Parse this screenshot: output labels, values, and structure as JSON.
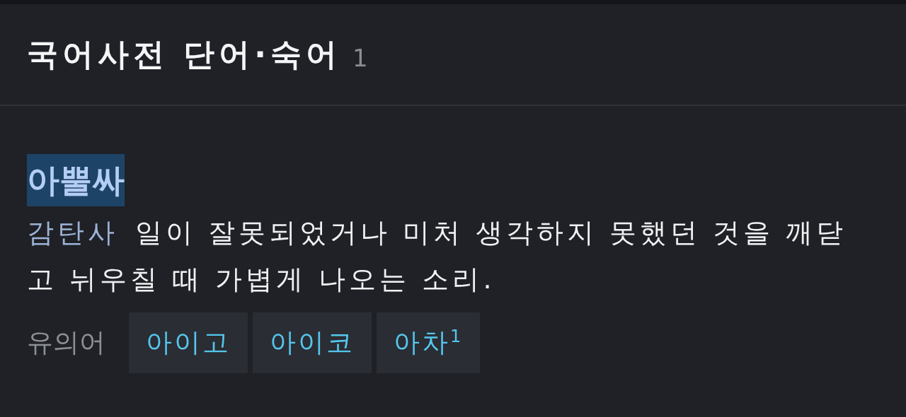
{
  "section": {
    "title": "국어사전 단어·숙어",
    "count": "1"
  },
  "entry": {
    "headword": "아뿔싸",
    "highlighted": true,
    "part_of_speech": "감탄사",
    "definition": "일이 잘못되었거나 미처 생각하지 못했던 것을 깨닫고 뉘우칠 때 가볍게 나오는 소리.",
    "synonyms_label": "유의어",
    "synonyms": [
      {
        "word": "아이고"
      },
      {
        "word": "아이코"
      },
      {
        "word": "아차$^{1}$"
      }
    ]
  }
}
